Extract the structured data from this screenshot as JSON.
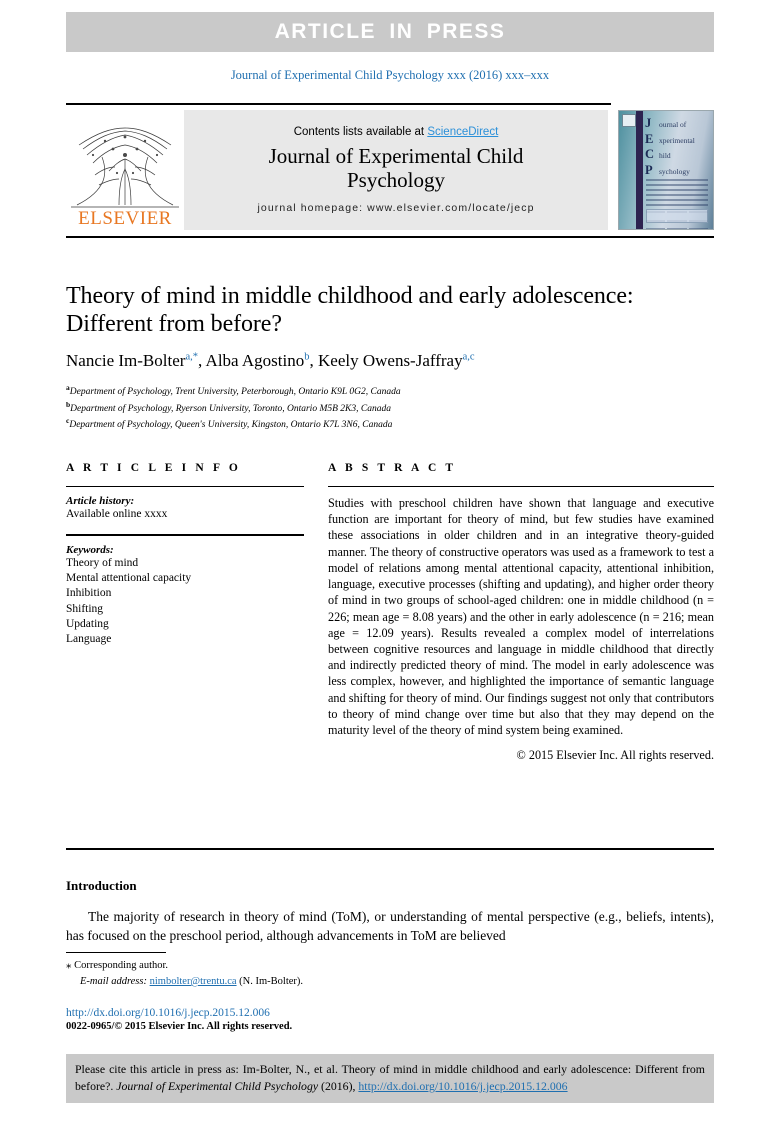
{
  "banner": {
    "text": "ARTICLE IN PRESS"
  },
  "running_head": "Journal of Experimental Child Psychology xxx (2016) xxx–xxx",
  "masthead": {
    "contents_prefix": "Contents lists available at ",
    "sciencedirect": "ScienceDirect",
    "journal_title_line1": "Journal of Experimental Child",
    "journal_title_line2": "Psychology",
    "homepage": "journal homepage: www.elsevier.com/locate/jecp",
    "publisher": "ELSEVIER",
    "cover": {
      "letters": "J\nE\nC\nP",
      "word1": "ournal of",
      "word2": "xperimental",
      "word3": "hild",
      "word4": "sychology"
    }
  },
  "article": {
    "title": "Theory of mind in middle childhood and early adolescence: Different from before?",
    "authors": [
      {
        "name": "Nancie Im-Bolter",
        "marks": "a,*"
      },
      {
        "name": "Alba Agostino",
        "marks": "b"
      },
      {
        "name": "Keely Owens-Jaffray",
        "marks": "a,c"
      }
    ],
    "affiliations": [
      {
        "mark": "a",
        "text": "Department of Psychology, Trent University, Peterborough, Ontario K9L 0G2, Canada"
      },
      {
        "mark": "b",
        "text": "Department of Psychology, Ryerson University, Toronto, Ontario M5B 2K3, Canada"
      },
      {
        "mark": "c",
        "text": "Department of Psychology, Queen's University, Kingston, Ontario K7L 3N6, Canada"
      }
    ]
  },
  "info": {
    "heading": "A R T I C L E   I N F O",
    "history_label": "Article history:",
    "history_value": "Available online xxxx",
    "keywords_label": "Keywords:",
    "keywords": [
      "Theory of mind",
      "Mental attentional capacity",
      "Inhibition",
      "Shifting",
      "Updating",
      "Language"
    ]
  },
  "abstract": {
    "heading": "A B S T R A C T",
    "text": "Studies with preschool children have shown that language and executive function are important for theory of mind, but few studies have examined these associations in older children and in an integrative theory-guided manner. The theory of constructive operators was used as a framework to test a model of relations among mental attentional capacity, attentional inhibition, language, executive processes (shifting and updating), and higher order theory of mind in two groups of school-aged children: one in middle childhood (n = 226; mean age = 8.08 years) and the other in early adolescence (n = 216; mean age = 12.09 years). Results revealed a complex model of interrelations between cognitive resources and language in middle childhood that directly and indirectly predicted theory of mind. The model in early adolescence was less complex, however, and highlighted the importance of semantic language and shifting for theory of mind. Our findings suggest not only that contributors to theory of mind change over time but also that they may depend on the maturity level of the theory of mind system being examined.",
    "copyright": "© 2015 Elsevier Inc. All rights reserved."
  },
  "introduction": {
    "heading": "Introduction",
    "paragraph": "The majority of research in theory of mind (ToM), or understanding of mental perspective (e.g., beliefs, intents), has focused on the preschool period, although advancements in ToM are believed"
  },
  "footnotes": {
    "corresponding_star": "⁎",
    "corresponding_text": "Corresponding author.",
    "email_label": "E-mail address:",
    "email": "nimbolter@trentu.ca",
    "email_owner": "(N. Im-Bolter).",
    "doi": "http://dx.doi.org/10.1016/j.jecp.2015.12.006",
    "issn_line": "0022-0965/© 2015 Elsevier Inc. All rights reserved."
  },
  "cite_box": {
    "prefix": "Please cite this article in press as: Im-Bolter, N., et al. Theory of mind in middle childhood and early adolescence: Different from before?. ",
    "journal_italic": "Journal of Experimental Child Psychology",
    "year": " (2016), ",
    "url": "http://dx.doi.org/10.1016/j.jecp.2015.12.006"
  },
  "colors": {
    "link_blue": "#1f6fb0",
    "sciencedirect_blue": "#2b90d9",
    "elsevier_orange": "#e87722",
    "banner_gray": "#c9c9c9",
    "masthead_gray": "#e8e8e8"
  }
}
